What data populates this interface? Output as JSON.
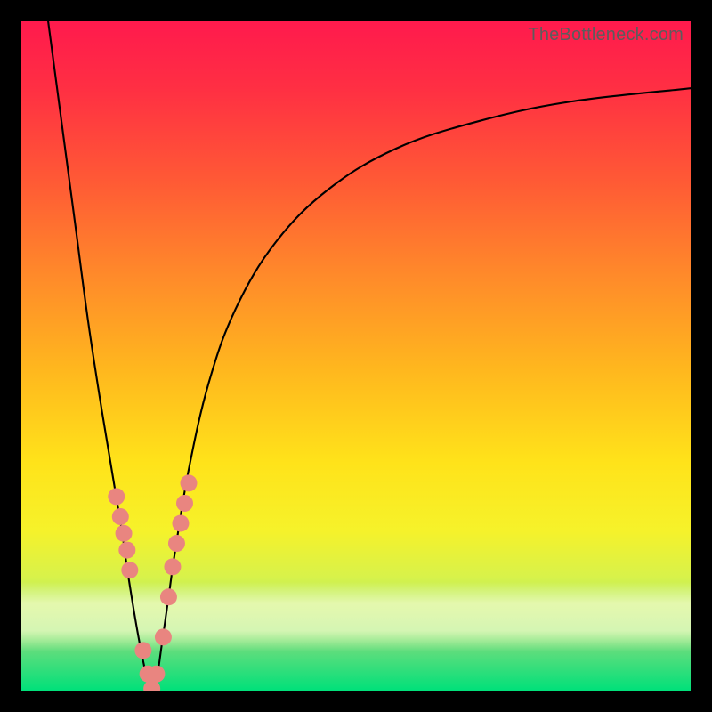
{
  "watermark": "TheBottleneck.com",
  "chart_data": {
    "type": "line",
    "title": "",
    "xlabel": "",
    "ylabel": "",
    "xlim": [
      0,
      100
    ],
    "ylim": [
      0,
      100
    ],
    "grid": false,
    "series": [
      {
        "name": "bottleneck-curve",
        "x": [
          4,
          6,
          8,
          10,
          12,
          14,
          15,
          16,
          17.5,
          18.75,
          19.5,
          20.25,
          21,
          22,
          23,
          25,
          28,
          32,
          38,
          46,
          56,
          68,
          82,
          100
        ],
        "values": [
          100,
          85,
          70,
          55,
          42,
          30,
          24,
          17,
          8,
          2,
          0.2,
          2,
          7,
          14,
          21,
          33,
          46,
          57,
          67,
          75,
          81,
          85,
          88,
          90
        ]
      }
    ],
    "markers": {
      "name": "highlighted-range-dots",
      "color": "#e98580",
      "x": [
        14.2,
        14.8,
        15.3,
        15.8,
        16.2,
        18.2,
        18.9,
        19.5,
        20.2,
        21.2,
        22.0,
        22.6,
        23.2,
        23.8,
        24.4,
        25.0
      ],
      "values": [
        29,
        26,
        23.5,
        21,
        18,
        6,
        2.5,
        0.3,
        2.5,
        8,
        14,
        18.5,
        22,
        25,
        28,
        31
      ]
    }
  }
}
